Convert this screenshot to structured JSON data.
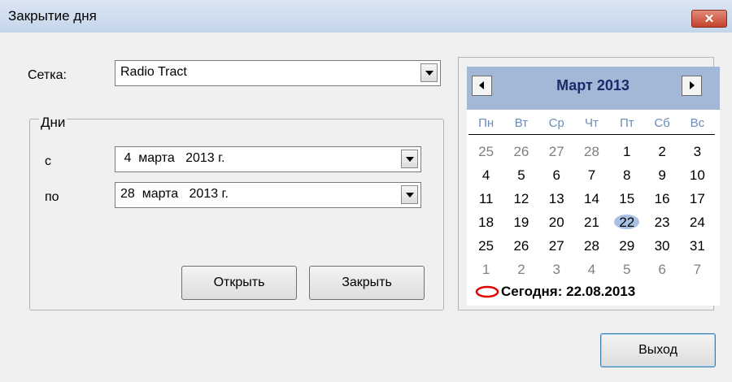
{
  "window": {
    "title": "Закрытие дня",
    "close_symbol": "✕"
  },
  "form": {
    "grid_label": "Сетка:",
    "grid_value": "Radio Tract",
    "days_group_title": "Дни",
    "from_label": "с",
    "from_value": " 4  марта   2013 г.",
    "to_label": "по",
    "to_value": "28  марта   2013 г.",
    "open_button": "Открыть",
    "close_button": "Закрыть"
  },
  "calendar": {
    "month_title": "Март 2013",
    "weekdays": [
      "Пн",
      "Вт",
      "Ср",
      "Чт",
      "Пт",
      "Сб",
      "Вс"
    ],
    "weeks": [
      [
        {
          "d": "25",
          "m": true
        },
        {
          "d": "26",
          "m": true
        },
        {
          "d": "27",
          "m": true
        },
        {
          "d": "28",
          "m": true
        },
        {
          "d": "1"
        },
        {
          "d": "2"
        },
        {
          "d": "3"
        }
      ],
      [
        {
          "d": "4"
        },
        {
          "d": "5"
        },
        {
          "d": "6"
        },
        {
          "d": "7"
        },
        {
          "d": "8"
        },
        {
          "d": "9"
        },
        {
          "d": "10"
        }
      ],
      [
        {
          "d": "11"
        },
        {
          "d": "12"
        },
        {
          "d": "13"
        },
        {
          "d": "14"
        },
        {
          "d": "15"
        },
        {
          "d": "16"
        },
        {
          "d": "17"
        }
      ],
      [
        {
          "d": "18"
        },
        {
          "d": "19"
        },
        {
          "d": "20"
        },
        {
          "d": "21"
        },
        {
          "d": "22",
          "sel": true
        },
        {
          "d": "23"
        },
        {
          "d": "24"
        }
      ],
      [
        {
          "d": "25"
        },
        {
          "d": "26"
        },
        {
          "d": "27"
        },
        {
          "d": "28"
        },
        {
          "d": "29"
        },
        {
          "d": "30"
        },
        {
          "d": "31"
        }
      ],
      [
        {
          "d": "1",
          "m": true
        },
        {
          "d": "2",
          "m": true
        },
        {
          "d": "3",
          "m": true
        },
        {
          "d": "4",
          "m": true
        },
        {
          "d": "5",
          "m": true
        },
        {
          "d": "6",
          "m": true
        },
        {
          "d": "7",
          "m": true
        }
      ]
    ],
    "today_text": "Сегодня: 22.08.2013",
    "today_marker_color": "#e00000",
    "selected_color": "#a9c1e2",
    "header_color": "#a2b8d6"
  },
  "exit_button": "Выход"
}
